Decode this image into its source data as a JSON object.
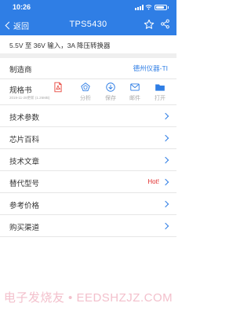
{
  "status": {
    "time": "10:26"
  },
  "nav": {
    "back_label": "返回",
    "title": "TPS5430"
  },
  "description": "5.5V 至 36V 输入，3A 降压转换器",
  "manufacturer": {
    "label": "制造商",
    "value": "德州仪器-TI"
  },
  "spec": {
    "label": "规格书",
    "meta": "2019-11-28更新 (1.26MB)",
    "actions": [
      "分析",
      "保存",
      "邮件",
      "打开"
    ]
  },
  "rows": [
    {
      "label": "技术参数"
    },
    {
      "label": "芯片百科"
    },
    {
      "label": "技术文章"
    },
    {
      "label": "替代型号",
      "badge": "Hot!"
    },
    {
      "label": "参考价格"
    },
    {
      "label": "购买渠道"
    }
  ],
  "watermark": "电子发烧友 • EEDSHZJZ.COM",
  "colors": {
    "accent": "#2f7ee5",
    "hot": "#e02a2a",
    "pdf": "#e8463d"
  }
}
